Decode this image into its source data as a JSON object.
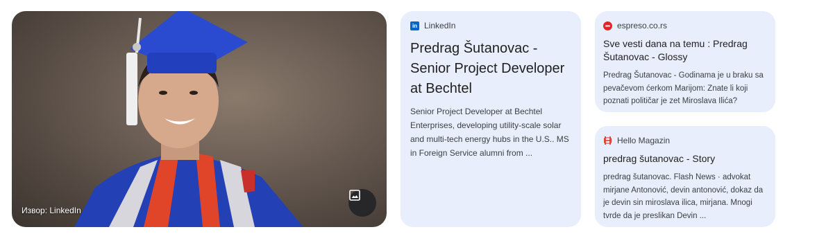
{
  "hero": {
    "source_label": "Извор: LinkedIn",
    "image_button_icon": "image-icon"
  },
  "cards": {
    "linkedin": {
      "source": "LinkedIn",
      "title": "Predrag Šutanovac - Senior Project Developer at Bechtel",
      "snippet": "Senior Project Developer at Bechtel Enterprises, developing utility-scale solar and multi-tech energy hubs in the U.S.. MS in Foreign Service alumni from ..."
    },
    "espreso": {
      "source": "espreso.co.rs",
      "title": "Sve vesti dana na temu : Predrag Šutanovac - Glossy",
      "snippet": "Predrag Šutanovac - Godinama je u braku sa pevačevom ćerkom Marijom: Znate li koji poznati političar je zet Miroslava Ilića?"
    },
    "hello": {
      "source": "Hello Magazin",
      "title": "predrag šutanovac - Story",
      "snippet": "predrag šutanovac. Flash News · advokat mirjane Antonović, devin antonović, dokaz da je devin sin miroslava ilica, mirjana. Mnogi tvrde da je preslikan Devin ..."
    }
  },
  "colors": {
    "card_bg": "#e8eefb",
    "linkedin_brand": "#0a66c2",
    "espreso_brand": "#e52329",
    "hello_brand": "#d93025"
  }
}
